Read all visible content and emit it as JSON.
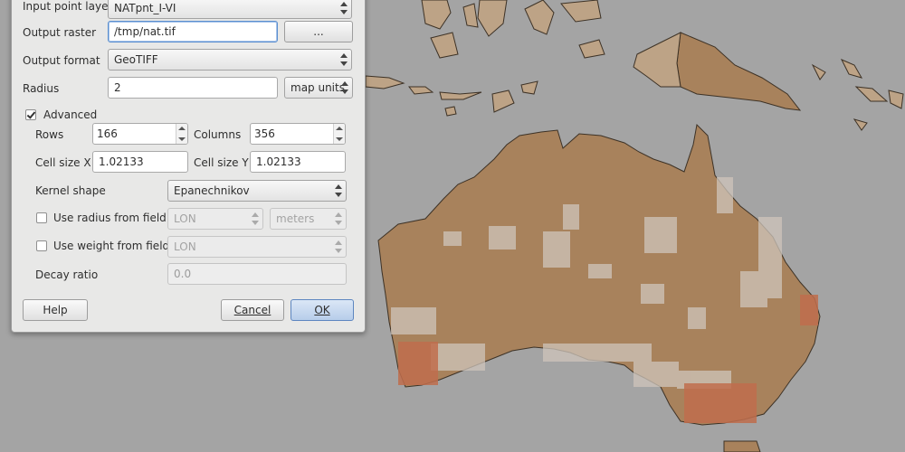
{
  "dialog": {
    "input_point_layer": {
      "label": "Input point layer",
      "value": "NATpnt_I-VI"
    },
    "output_raster": {
      "label": "Output raster",
      "value": "/tmp/nat.tif",
      "browse_label": "..."
    },
    "output_format": {
      "label": "Output format",
      "value": "GeoTIFF"
    },
    "radius": {
      "label": "Radius",
      "value": "2",
      "units": "map units"
    },
    "advanced": {
      "label": "Advanced",
      "checked": true
    },
    "rows": {
      "label": "Rows",
      "value": "166"
    },
    "columns": {
      "label": "Columns",
      "value": "356"
    },
    "cell_size_x": {
      "label": "Cell size X",
      "value": "1.02133"
    },
    "cell_size_y": {
      "label": "Cell size Y",
      "value": "1.02133"
    },
    "kernel_shape": {
      "label": "Kernel shape",
      "value": "Epanechnikov"
    },
    "use_radius_from_field": {
      "label": "Use radius from field",
      "checked": false,
      "field": "LON",
      "units": "meters"
    },
    "use_weight_from_field": {
      "label": "Use weight from field",
      "checked": false,
      "field": "LON"
    },
    "decay_ratio": {
      "label": "Decay ratio",
      "value": "0.0"
    },
    "buttons": {
      "help": "Help",
      "cancel": "Cancel",
      "ok": "OK"
    }
  },
  "colors": {
    "map_background": "#a4a4a4",
    "land_low": "#cfc5bb",
    "land_mid": "#a8825c",
    "land_high": "#c06d4c",
    "coastline": "#3d3226"
  }
}
